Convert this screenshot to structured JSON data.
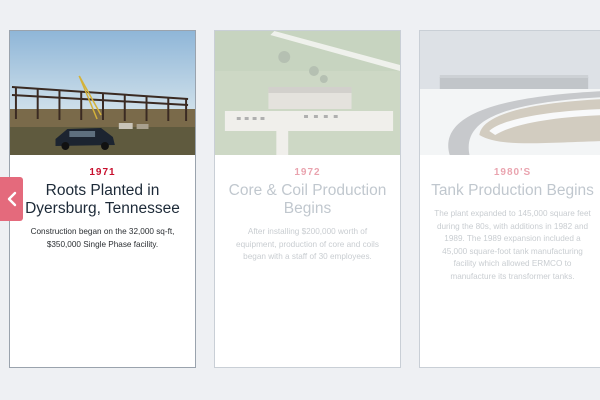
{
  "timeline": {
    "cards": [
      {
        "year": "1971",
        "title": "Roots Planted in Dyersburg, Tennessee",
        "description": "Construction began on the 32,000 sq-ft, $350,000 Single Phase facility.",
        "photo_icon": "construction-site-photo",
        "active": true
      },
      {
        "year": "1972",
        "title": "Core & Coil Production Begins",
        "description": "After installing $200,000 worth of equipment, production of core and coils began with a staff of 30 employees.",
        "photo_icon": "aerial-plant-photo",
        "active": false
      },
      {
        "year": "1980'S",
        "title": "Tank Production Begins",
        "description": "The plant expanded to 145,000 square feet during the 80s, with additions in 1982 and 1989. The 1989 expansion included a 45,000 square-foot tank manufacturing facility which allowed ERMCO to manufacture its transformer tanks.",
        "photo_icon": "factory-snow-photo",
        "active": false
      }
    ]
  },
  "navigation": {
    "prev_icon": "chevron-left-icon"
  },
  "colors": {
    "accent": "#c8102e",
    "nav_button": "#e46a7c",
    "background": "#eef0f3"
  }
}
